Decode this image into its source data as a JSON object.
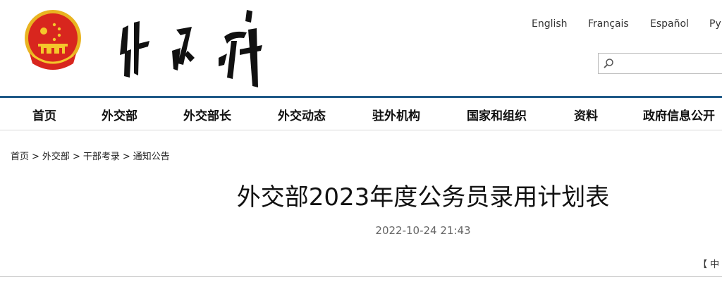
{
  "languages": {
    "english": "English",
    "francais": "Français",
    "espanol": "Español",
    "russian": "Ру"
  },
  "search": {
    "placeholder": ""
  },
  "nav": {
    "items": [
      "首页",
      "外交部",
      "外交部长",
      "外交动态",
      "驻外机构",
      "国家和组织",
      "资料",
      "政府信息公开"
    ]
  },
  "breadcrumb": {
    "items": [
      "首页",
      "外交部",
      "干部考录",
      "通知公告"
    ],
    "separator": ">"
  },
  "article": {
    "title": "外交部2023年度公务员录用计划表",
    "datetime": "2022-10-24 21:43"
  },
  "font_size_control": {
    "bracket": "【",
    "label": "中"
  },
  "colors": {
    "accent_rule": "#1f5a88",
    "emblem_red": "#d8261e",
    "emblem_gold": "#f4c72b"
  }
}
